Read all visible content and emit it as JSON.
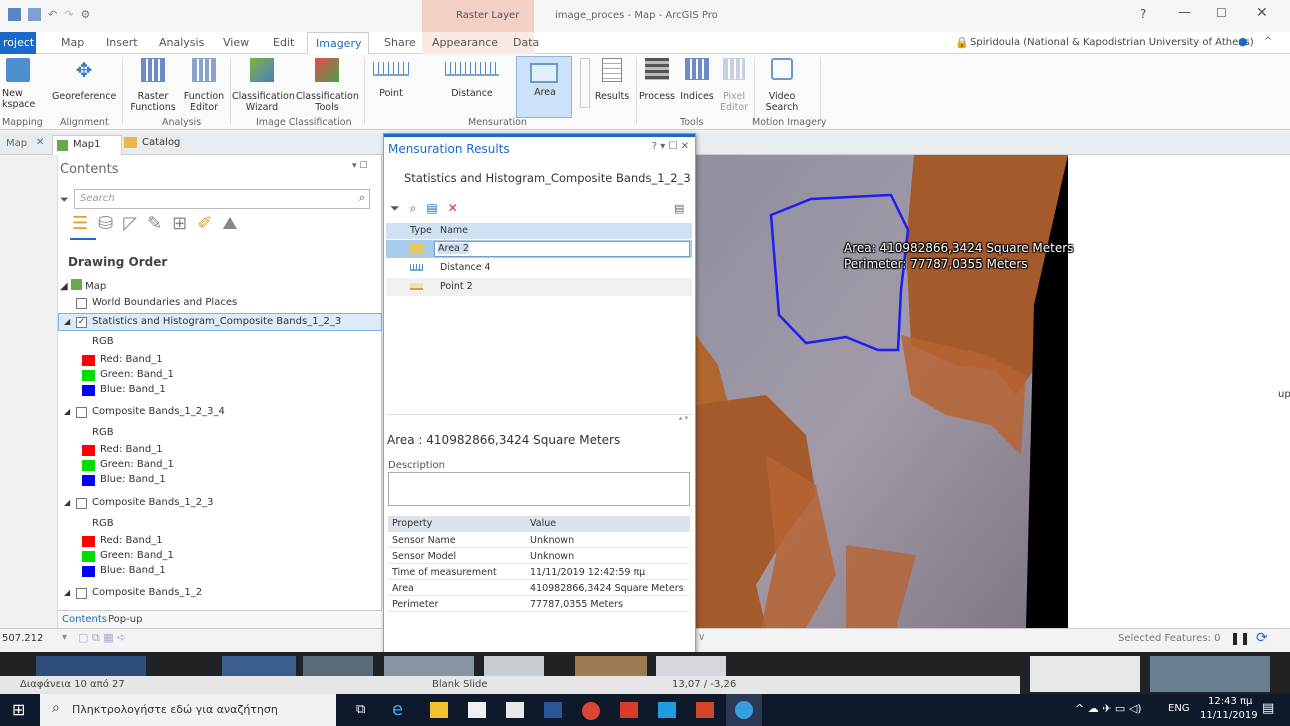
{
  "window": {
    "title": "image_proces - Map - ArcGIS Pro",
    "context_tab": "Raster Layer",
    "help": "?",
    "user": "Spiridoula (National & Kapodistrian University of Athens)"
  },
  "ribbon_tabs": [
    "roject",
    "Map",
    "Insert",
    "Analysis",
    "View",
    "Edit",
    "Imagery",
    "Share",
    "Appearance",
    "Data"
  ],
  "ribbon": {
    "new_workspace": "New\nkspace",
    "georeference": "Georeference",
    "raster_functions": "Raster\nFunctions",
    "function_editor": "Function\nEditor",
    "classification_wizard": "Classification\nWizard",
    "classification_tools": "Classification\nTools",
    "point": "Point",
    "distance": "Distance",
    "area": "Area",
    "results": "Results",
    "process": "Process",
    "indices": "Indices",
    "pixel_editor": "Pixel\nEditor",
    "video_search": "Video\nSearch",
    "groups": [
      "Mapping",
      "Alignment",
      "Analysis",
      "Image Classification",
      "Mensuration",
      "Tools",
      "Motion Imagery"
    ]
  },
  "doc_tabs": [
    "Map",
    "Map1",
    "Catalog"
  ],
  "contents": {
    "title": "Contents",
    "search_placeholder": "Search",
    "drawing_order": "Drawing Order",
    "map_label": "Map",
    "layers": [
      {
        "name": "World Boundaries and Places"
      },
      {
        "name": "Statistics and Histogram_Composite Bands_1_2_3",
        "rgb": "RGB",
        "bands": [
          "Red:  Band_1",
          "Green: Band_1",
          "Blue:  Band_1"
        ]
      },
      {
        "name": "Composite Bands_1_2_3_4",
        "rgb": "RGB",
        "bands": [
          "Red:  Band_1",
          "Green: Band_1",
          "Blue:  Band_1"
        ]
      },
      {
        "name": "Composite Bands_1_2_3",
        "rgb": "RGB",
        "bands": [
          "Red:  Band_1",
          "Green: Band_1",
          "Blue:  Band_1"
        ]
      },
      {
        "name": "Composite Bands_1_2"
      }
    ],
    "bottom_tabs": [
      "Contents",
      "Pop-up"
    ],
    "colors": {
      "red": "#ff0000",
      "green": "#00dd00",
      "blue": "#0000ff"
    }
  },
  "dialog": {
    "title": "Mensuration Results",
    "controls": "? ▾ ☐ ✕",
    "subtitle": "Statistics and Histogram_Composite Bands_1_2_3",
    "col_type": "Type",
    "col_name": "Name",
    "rows": [
      "Area 2",
      "Distance 4",
      "Point 2"
    ],
    "detail_title": "Area : 410982866,3424 Square Meters",
    "description_label": "Description",
    "prop_header": "Property",
    "value_header": "Value",
    "properties": [
      {
        "property": "Sensor Name",
        "value": "Unknown"
      },
      {
        "property": "Sensor Model",
        "value": "Unknown"
      },
      {
        "property": "Time of measurement",
        "value": "11/11/2019 12:42:59 πμ"
      },
      {
        "property": "Area",
        "value": "410982866,3424 Square Meters"
      },
      {
        "property": "Perimeter",
        "value": "77787,0355 Meters"
      }
    ]
  },
  "map": {
    "label_area": "Area: 410982866,3424 Square Meters",
    "label_perimeter": "Perimeter: 77787,0355 Meters",
    "edge_text": "up"
  },
  "status": {
    "scale": "507.212",
    "selected_features": "Selected Features: 0"
  },
  "slides": {
    "counter": "Διαφάνεια 10 από 27",
    "layout": "Blank Slide",
    "coords": "13,07 / -3,26"
  },
  "taskbar": {
    "search_placeholder": "Πληκτρολογήστε εδώ για αναζήτηση",
    "lang": "ENG",
    "time": "12:43 πμ",
    "date": "11/11/2019"
  }
}
